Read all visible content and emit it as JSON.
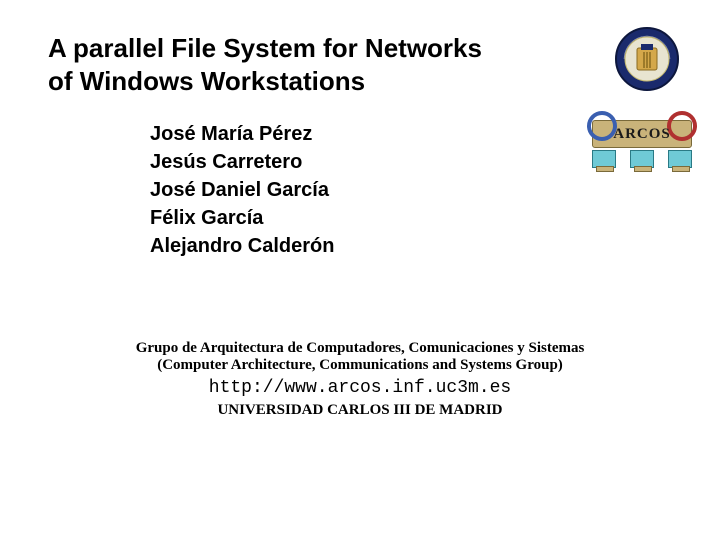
{
  "title": "A parallel File System for Networks of Windows Workstations",
  "authors": [
    "José María Pérez",
    "Jesús Carretero",
    "José Daniel García",
    "Félix García",
    "Alejandro Calderón"
  ],
  "footer": {
    "group_es": "Grupo de Arquitectura de Computadores, Comunicaciones y Sistemas",
    "group_en": "(Computer Architecture, Communications and Systems Group)",
    "url": "http://www.arcos.inf.uc3m.es",
    "university": "UNIVERSIDAD CARLOS III DE MADRID"
  },
  "logos": {
    "arcos_label": "ARCOS"
  }
}
